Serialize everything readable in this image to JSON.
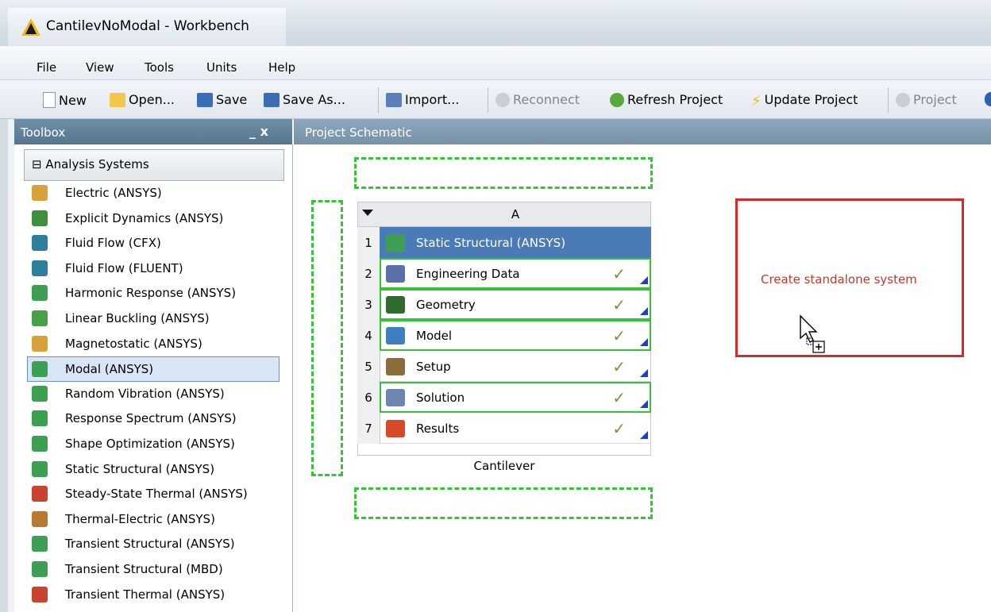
{
  "window": {
    "title": "CantilevNoModal - Workbench"
  },
  "menu": [
    "File",
    "View",
    "Tools",
    "Units",
    "Help"
  ],
  "toolbar": {
    "new": "New",
    "open": "Open...",
    "save": "Save",
    "save_as": "Save As...",
    "import": "Import...",
    "reconnect": "Reconnect",
    "refresh": "Refresh Project",
    "update": "Update Project",
    "project": "Project"
  },
  "toolbox": {
    "title": "Toolbox",
    "controls": "_ x",
    "group": "⊟ Analysis Systems",
    "items": [
      {
        "label": "Electric (ANSYS)",
        "icon": "electric-icon",
        "color": "#d8a23a"
      },
      {
        "label": "Explicit Dynamics (ANSYS)",
        "icon": "explicit-dynamics-icon",
        "color": "#3e8f3e"
      },
      {
        "label": "Fluid Flow (CFX)",
        "icon": "cfx-icon",
        "color": "#2f7f9a"
      },
      {
        "label": "Fluid Flow (FLUENT)",
        "icon": "fluent-icon",
        "color": "#2f7f9a"
      },
      {
        "label": "Harmonic Response (ANSYS)",
        "icon": "harmonic-icon",
        "color": "#3e9f52"
      },
      {
        "label": "Linear Buckling (ANSYS)",
        "icon": "buckling-icon",
        "color": "#4aa04a"
      },
      {
        "label": "Magnetostatic (ANSYS)",
        "icon": "magnetostatic-icon",
        "color": "#d8a23a"
      },
      {
        "label": "Modal (ANSYS)",
        "icon": "modal-icon",
        "color": "#3e9f52"
      },
      {
        "label": "Random Vibration (ANSYS)",
        "icon": "random-vibration-icon",
        "color": "#3e9f52"
      },
      {
        "label": "Response Spectrum (ANSYS)",
        "icon": "response-spectrum-icon",
        "color": "#3e9f52"
      },
      {
        "label": "Shape Optimization (ANSYS)",
        "icon": "shape-optimization-icon",
        "color": "#3e9f52"
      },
      {
        "label": "Static Structural (ANSYS)",
        "icon": "static-structural-icon",
        "color": "#3e9f52"
      },
      {
        "label": "Steady-State Thermal (ANSYS)",
        "icon": "thermal-icon",
        "color": "#c8442e"
      },
      {
        "label": "Thermal-Electric (ANSYS)",
        "icon": "thermal-electric-icon",
        "color": "#b87a2e"
      },
      {
        "label": "Transient Structural (ANSYS)",
        "icon": "transient-structural-icon",
        "color": "#3e9f52"
      },
      {
        "label": "Transient Structural (MBD)",
        "icon": "transient-mbd-icon",
        "color": "#3e9f52"
      },
      {
        "label": "Transient Thermal (ANSYS)",
        "icon": "transient-thermal-icon",
        "color": "#c8442e"
      }
    ]
  },
  "schematic": {
    "title": "Project Schematic",
    "system": {
      "column": "A",
      "name": "Cantilever",
      "rows": [
        {
          "num": "1",
          "label": "Static Structural (ANSYS)",
          "icon": "static-structural-icon",
          "color": "#3e9f52"
        },
        {
          "num": "2",
          "label": "Engineering Data",
          "icon": "engineering-data-icon",
          "color": "#5b6fa8",
          "check": "✓"
        },
        {
          "num": "3",
          "label": "Geometry",
          "icon": "geometry-icon",
          "color": "#2e6b2e",
          "check": "✓"
        },
        {
          "num": "4",
          "label": "Model",
          "icon": "model-icon",
          "color": "#3f7fbf",
          "check": "✓"
        },
        {
          "num": "5",
          "label": "Setup",
          "icon": "setup-icon",
          "color": "#8a6d3b",
          "check": "✓"
        },
        {
          "num": "6",
          "label": "Solution",
          "icon": "solution-icon",
          "color": "#6b86b0",
          "check": "✓"
        },
        {
          "num": "7",
          "label": "Results",
          "icon": "results-icon",
          "color": "#d64a2a",
          "check": "✓"
        }
      ]
    },
    "drop_target": "Create standalone system"
  },
  "colors": {
    "selected_header": "#4a7bb7",
    "accent_green": "#36c436",
    "drop_red": "#d42a2a"
  }
}
